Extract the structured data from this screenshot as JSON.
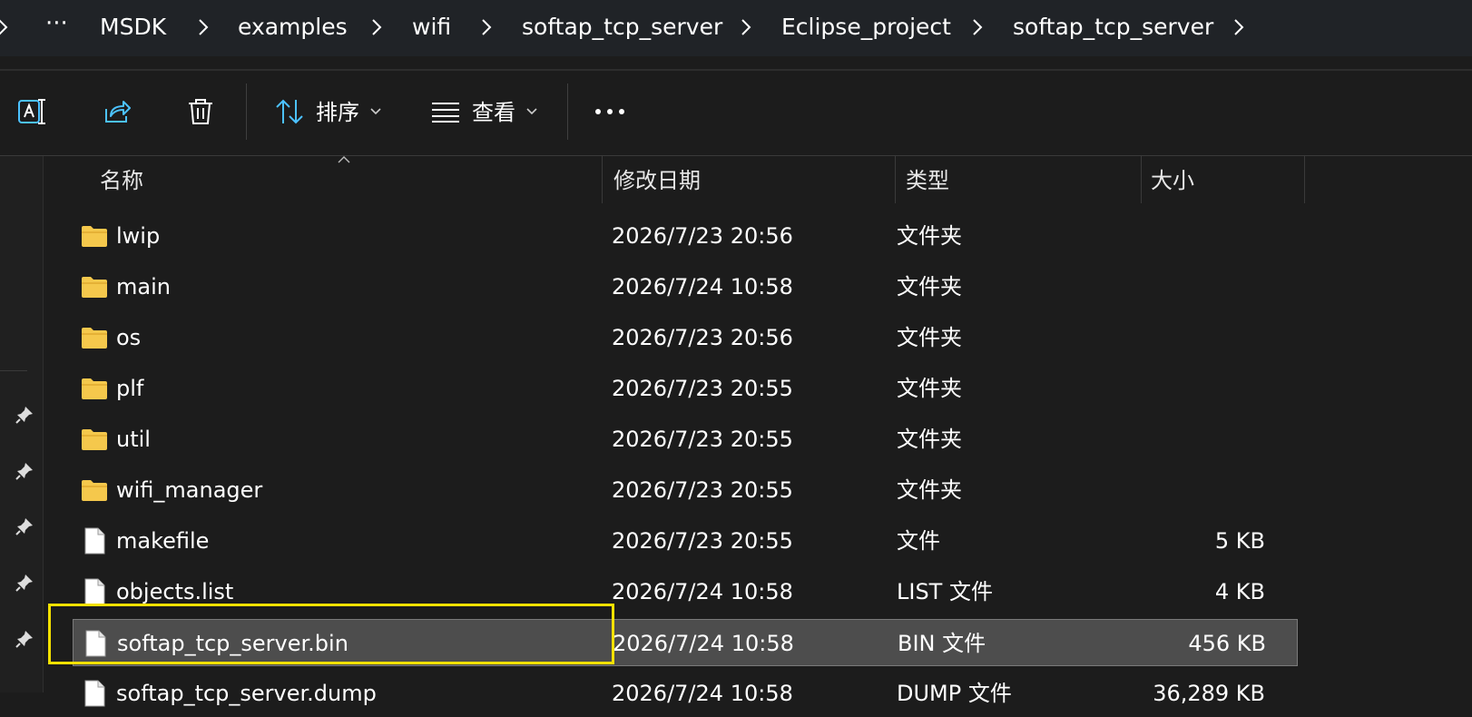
{
  "addressbar": {
    "more": "···",
    "crumbs": [
      "MSDK",
      "examples",
      "wifi",
      "softap_tcp_server",
      "Eclipse_project",
      "softap_tcp_server"
    ]
  },
  "toolbar": {
    "sort_label": "排序",
    "view_label": "查看",
    "more": "•••",
    "icons": [
      "rename-icon",
      "share-icon",
      "delete-icon",
      "sort-icon",
      "view-icon",
      "more-icon"
    ]
  },
  "columns": {
    "name": "名称",
    "modified": "修改日期",
    "type": "类型",
    "size": "大小"
  },
  "files": [
    {
      "name": "lwip",
      "modified": "2026/7/23 20:56",
      "type": "文件夹",
      "size": "",
      "icon": "folder-icon"
    },
    {
      "name": "main",
      "modified": "2026/7/24 10:58",
      "type": "文件夹",
      "size": "",
      "icon": "folder-icon"
    },
    {
      "name": "os",
      "modified": "2026/7/23 20:56",
      "type": "文件夹",
      "size": "",
      "icon": "folder-icon"
    },
    {
      "name": "plf",
      "modified": "2026/7/23 20:55",
      "type": "文件夹",
      "size": "",
      "icon": "folder-icon"
    },
    {
      "name": "util",
      "modified": "2026/7/23 20:55",
      "type": "文件夹",
      "size": "",
      "icon": "folder-icon"
    },
    {
      "name": "wifi_manager",
      "modified": "2026/7/23 20:55",
      "type": "文件夹",
      "size": "",
      "icon": "folder-icon"
    },
    {
      "name": "makefile",
      "modified": "2026/7/23 20:55",
      "type": "文件",
      "size": "5 KB",
      "icon": "file-icon"
    },
    {
      "name": "objects.list",
      "modified": "2026/7/24 10:58",
      "type": "LIST 文件",
      "size": "4 KB",
      "icon": "file-icon"
    },
    {
      "name": "softap_tcp_server.bin",
      "modified": "2026/7/24 10:58",
      "type": "BIN 文件",
      "size": "456 KB",
      "icon": "file-icon",
      "selected": true
    },
    {
      "name": "softap_tcp_server.dump",
      "modified": "2026/7/24 10:58",
      "type": "DUMP 文件",
      "size": "36,289 KB",
      "icon": "file-icon"
    }
  ],
  "colors": {
    "highlight": "#f5e100",
    "folder": "#f5c84c",
    "accent": "#4cc2ff"
  }
}
